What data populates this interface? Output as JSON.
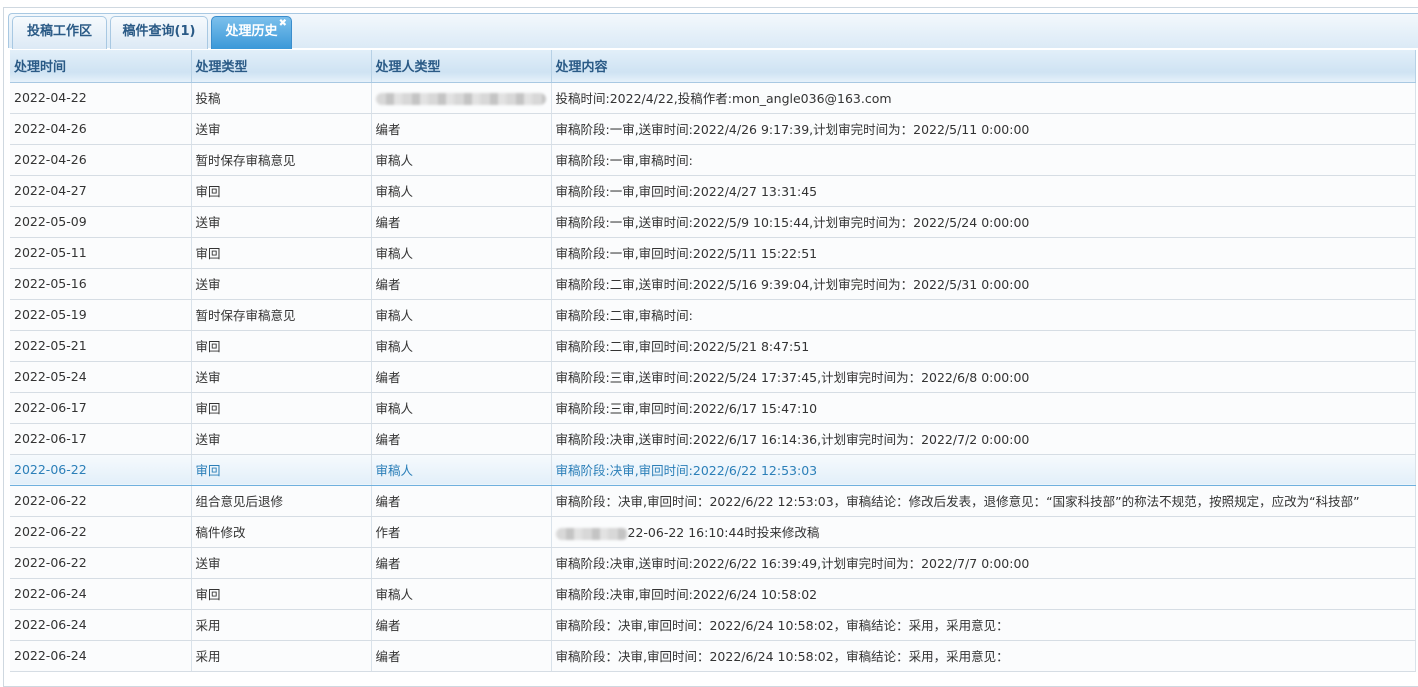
{
  "tabs": [
    {
      "label": "投稿工作区"
    },
    {
      "label": "稿件查询(1)"
    },
    {
      "label": "处理历史",
      "close": "✖"
    }
  ],
  "columns": [
    "处理时间",
    "处理类型",
    "处理人类型",
    "处理内容"
  ],
  "rows": [
    [
      "2022-04-22",
      "投稿",
      "",
      "投稿时间:2022/4/22,投稿作者:mon_angle036@163.com"
    ],
    [
      "2022-04-26",
      "送审",
      "编者",
      "审稿阶段:一审,送审时间:2022/4/26 9:17:39,计划审完时间为：2022/5/11 0:00:00"
    ],
    [
      "2022-04-26",
      "暂时保存审稿意见",
      "审稿人",
      "审稿阶段:一审,审稿时间:"
    ],
    [
      "2022-04-27",
      "审回",
      "审稿人",
      "审稿阶段:一审,审回时间:2022/4/27 13:31:45"
    ],
    [
      "2022-05-09",
      "送审",
      "编者",
      "审稿阶段:一审,送审时间:2022/5/9 10:15:44,计划审完时间为：2022/5/24 0:00:00"
    ],
    [
      "2022-05-11",
      "审回",
      "审稿人",
      "审稿阶段:一审,审回时间:2022/5/11 15:22:51"
    ],
    [
      "2022-05-16",
      "送审",
      "编者",
      "审稿阶段:二审,送审时间:2022/5/16 9:39:04,计划审完时间为：2022/5/31 0:00:00"
    ],
    [
      "2022-05-19",
      "暂时保存审稿意见",
      "审稿人",
      "审稿阶段:二审,审稿时间:"
    ],
    [
      "2022-05-21",
      "审回",
      "审稿人",
      "审稿阶段:二审,审回时间:2022/5/21 8:47:51"
    ],
    [
      "2022-05-24",
      "送审",
      "编者",
      "审稿阶段:三审,送审时间:2022/5/24 17:37:45,计划审完时间为：2022/6/8 0:00:00"
    ],
    [
      "2022-06-17",
      "审回",
      "审稿人",
      "审稿阶段:三审,审回时间:2022/6/17 15:47:10"
    ],
    [
      "2022-06-17",
      "送审",
      "编者",
      "审稿阶段:决审,送审时间:2022/6/17 16:14:36,计划审完时间为：2022/7/2 0:00:00"
    ],
    [
      "2022-06-22",
      "审回",
      "审稿人",
      "审稿阶段:决审,审回时间:2022/6/22 12:53:03"
    ],
    [
      "2022-06-22",
      "组合意见后退修",
      "编者",
      "审稿阶段：决审,审回时间：2022/6/22 12:53:03，审稿结论：修改后发表，退修意见：“国家科技部”的称法不规范，按照规定，应改为“科技部”"
    ],
    [
      "2022-06-22",
      "稿件修改",
      "作者",
      "22-06-22 16:10:44时投来修改稿"
    ],
    [
      "2022-06-22",
      "送审",
      "编者",
      "审稿阶段:决审,送审时间:2022/6/22 16:39:49,计划审完时间为：2022/7/7 0:00:00"
    ],
    [
      "2022-06-24",
      "审回",
      "审稿人",
      "审稿阶段:决审,审回时间:2022/6/24 10:58:02"
    ],
    [
      "2022-06-24",
      "采用",
      "编者",
      "审稿阶段：决审,审回时间：2022/6/24 10:58:02，审稿结论：采用，采用意见："
    ],
    [
      "2022-06-24",
      "采用",
      "编者",
      "审稿阶段：决审,审回时间：2022/6/24 10:58:02，审稿结论：采用，采用意见："
    ]
  ],
  "selected_row": 12,
  "blurred": {
    "0": 2,
    "14": 3
  }
}
